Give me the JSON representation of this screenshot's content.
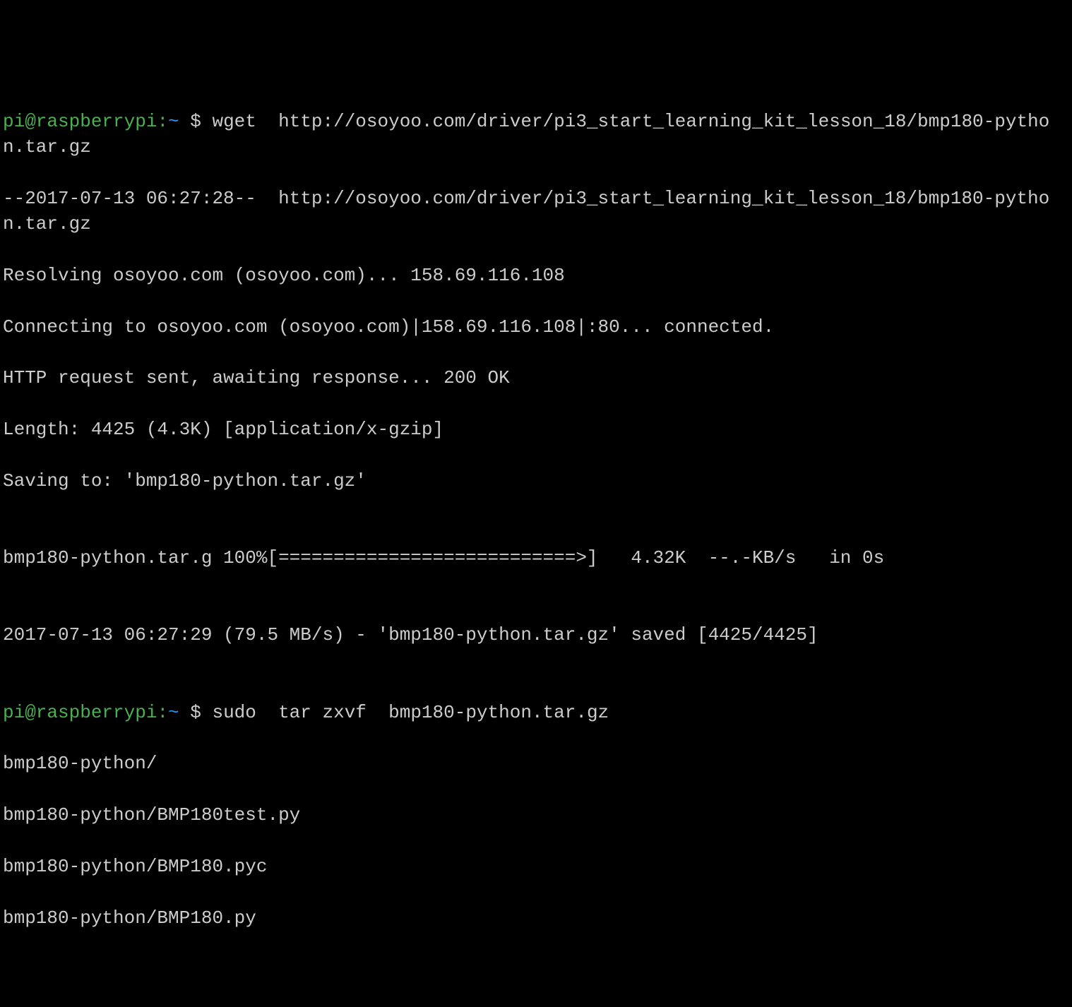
{
  "prompt1": {
    "user": "pi@raspberrypi",
    "sep": ":",
    "path": "~",
    "dollar": " $ ",
    "command": "wget  http://osoyoo.com/driver/pi3_start_learning_kit_lesson_18/bmp180-python.tar.gz"
  },
  "output1": {
    "line1": "--2017-07-13 06:27:28--  http://osoyoo.com/driver/pi3_start_learning_kit_lesson_18/bmp180-python.tar.gz",
    "line2": "Resolving osoyoo.com (osoyoo.com)... 158.69.116.108",
    "line3": "Connecting to osoyoo.com (osoyoo.com)|158.69.116.108|:80... connected.",
    "line4": "HTTP request sent, awaiting response... 200 OK",
    "line5": "Length: 4425 (4.3K) [application/x-gzip]",
    "line6": "Saving to: 'bmp180-python.tar.gz'",
    "blank1": "",
    "line7": "bmp180-python.tar.g 100%[===========================>]   4.32K  --.-KB/s   in 0s",
    "blank2": "",
    "line8": "2017-07-13 06:27:29 (79.5 MB/s) - 'bmp180-python.tar.gz' saved [4425/4425]",
    "blank3": ""
  },
  "prompt2": {
    "user": "pi@raspberrypi",
    "sep": ":",
    "path": "~",
    "dollar": " $ ",
    "command": "sudo  tar zxvf  bmp180-python.tar.gz"
  },
  "output2": {
    "line1": "bmp180-python/",
    "line2": "bmp180-python/BMP180test.py",
    "line3": "bmp180-python/BMP180.pyc",
    "line4": "bmp180-python/BMP180.py"
  }
}
